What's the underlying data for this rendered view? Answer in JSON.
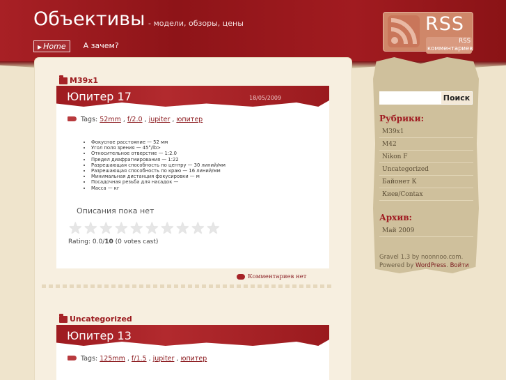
{
  "header": {
    "title": "Объективы",
    "description": "- модели, обзоры, цены",
    "nav": [
      {
        "label": "Home",
        "active": true
      },
      {
        "label": "А зачем?",
        "active": false
      }
    ],
    "rss": {
      "label": "RSS",
      "comments_label": "RSS комментариев"
    }
  },
  "posts": [
    {
      "category": "M39x1",
      "title": "Юпитер 17",
      "date": "18/05/2009",
      "tags_label": "Tags:",
      "tags": [
        "52mm",
        "f/2.0",
        "jupiter",
        "юпитер"
      ],
      "specs": [
        "Фокусное расстояние — 52 мм",
        "Угол поля зрения — 45°/lb>",
        "Относительное отверстие — 1:2.0",
        "Предел диафрагмирования — 1:22",
        "Разрешающая способность по центру — 30 линий/мм",
        "Разрешающая способность по краю — 16 линий/мм",
        "Минимальная дистанция фокусировки — м",
        "Посадочная резьба для насадок —",
        "Масса — кг"
      ],
      "no_description": "Описания пока нет",
      "rating_text": "Rating: 0.0/",
      "rating_max": "10",
      "rating_votes": " (0 votes cast)",
      "comments": "Комментариев нет"
    },
    {
      "category": "Uncategorized",
      "title": "Юпитер 13",
      "tags_label": "Tags:",
      "tags": [
        "125mm",
        "f/1.5",
        "jupiter",
        "юпитер"
      ]
    }
  ],
  "sidebar": {
    "search_placeholder": "",
    "search_button": "Поиск",
    "categories_heading": "Рубрики:",
    "categories": [
      "M39x1",
      "M42",
      "Nikon F",
      "Uncategorized",
      "Байонет К",
      "Киев/Contax"
    ],
    "archive_heading": "Архив:",
    "archive": [
      "Май 2009"
    ],
    "footer_line1": "Gravel 1.3 by noonnoo.com.",
    "footer_powered": "Powered by",
    "footer_wp": "WordPress",
    "footer_login": "Войти"
  },
  "colors": {
    "accent": "#9e1b20",
    "background": "#efe4cc",
    "sidebar": "#cfc09c"
  }
}
